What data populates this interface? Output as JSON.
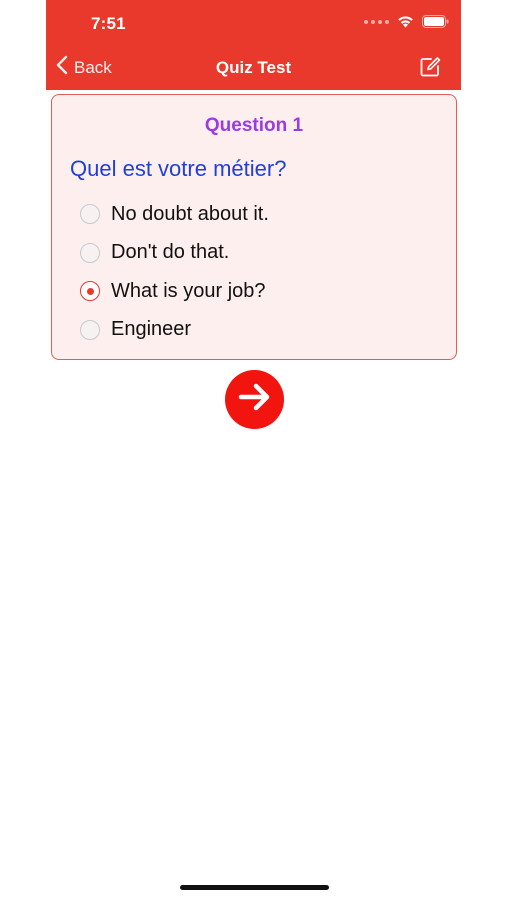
{
  "status_bar": {
    "time": "7:51"
  },
  "nav": {
    "back_label": "Back",
    "title": "Quiz Test"
  },
  "quiz": {
    "question_label": "Question 1",
    "question_text": "Quel est votre métier?",
    "options": [
      {
        "label": "No doubt about it.",
        "selected": false
      },
      {
        "label": "Don't do that.",
        "selected": false
      },
      {
        "label": "What is your job?",
        "selected": true
      },
      {
        "label": "Engineer",
        "selected": false
      }
    ]
  },
  "icons": {
    "back": "chevron-left-icon",
    "edit": "compose-icon",
    "next": "arrow-right-icon",
    "wifi": "wifi-icon",
    "battery": "battery-icon"
  },
  "colors": {
    "header": "#e8392c",
    "card_background": "#fdefee",
    "card_border": "#e65b52",
    "question_label": "#9b3be6",
    "question_text": "#1e3fd8",
    "next_button": "#f1140f"
  }
}
